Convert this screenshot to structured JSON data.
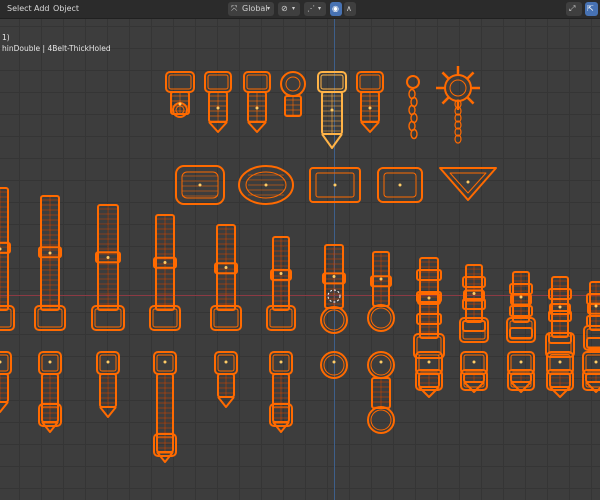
{
  "header": {
    "menu": [
      "Select",
      "Add",
      "Object"
    ],
    "transform_orientation": "Global"
  },
  "overlay": {
    "line1": "1)",
    "line2": "hinDouble | 4Belt-ThickHoled"
  },
  "colors": {
    "wire": "#ff6a00",
    "wire_dark": "#c84400",
    "active": "#ffb347",
    "grid": "#353535",
    "x_axis": "#8c3a44",
    "y_axis": "#3e5f8a",
    "header_bg": "#2b2b2b"
  },
  "icons": [
    "transform-orientation-icon",
    "pivot-icon",
    "snap-icon",
    "proportional-edit-icon",
    "falloff-icon",
    "viewport-gizmo-icon",
    "navigate-icon"
  ]
}
